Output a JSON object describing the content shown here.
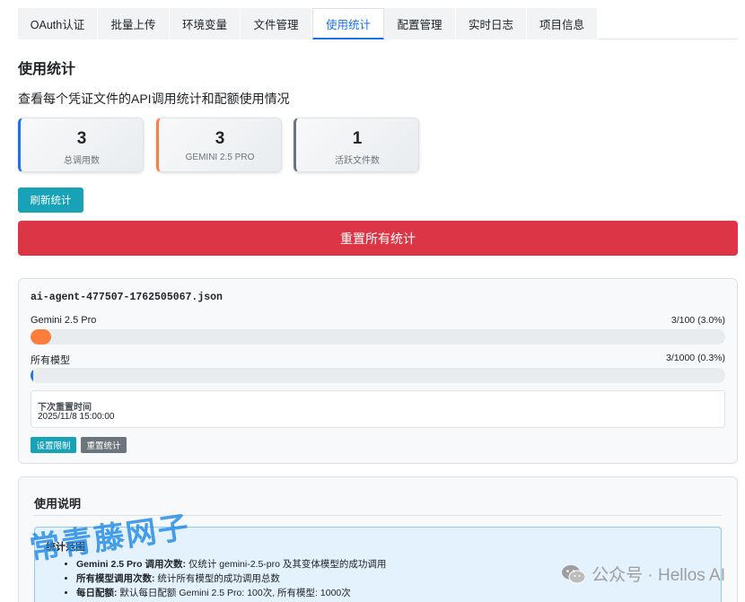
{
  "tabs": [
    {
      "label": "OAuth认证"
    },
    {
      "label": "批量上传"
    },
    {
      "label": "环境变量"
    },
    {
      "label": "文件管理"
    },
    {
      "label": "使用统计"
    },
    {
      "label": "配置管理"
    },
    {
      "label": "实时日志"
    },
    {
      "label": "项目信息"
    }
  ],
  "active_tab": "使用统计",
  "page": {
    "title": "使用统计",
    "description": "查看每个凭证文件的API调用统计和配额使用情况"
  },
  "stats": [
    {
      "value": "3",
      "label": "总调用数",
      "color": "#1a73e8"
    },
    {
      "value": "3",
      "label": "GEMINI 2.5 PRO",
      "color": "#fd7e3c"
    },
    {
      "value": "1",
      "label": "活跃文件数",
      "color": "#6c757d"
    }
  ],
  "buttons": {
    "refresh": "刷新统计",
    "reset_all": "重置所有统计"
  },
  "file": {
    "name": "ai-agent-477507-1762505067.json",
    "rows": [
      {
        "label": "Gemini 2.5 Pro",
        "value": "3/100 (3.0%)",
        "percent": 3.0,
        "color": "#fd7e3c"
      },
      {
        "label": "所有模型",
        "value": "3/1000 (0.3%)",
        "percent": 0.3,
        "color": "#1a73e8"
      }
    ],
    "next_reset_label": "下次重置时间",
    "next_reset_value": "2025/11/8 15:00:00",
    "set_limit": "设置限制",
    "reset_stats": "重置统计"
  },
  "help": {
    "title": "使用说明",
    "box_title": "统计范围",
    "items": [
      {
        "key": "Gemini 2.5 Pro 调用次数:",
        "text": " 仅统计 gemini-2.5-pro 及其变体模型的成功调用"
      },
      {
        "key": "所有模型调用次数:",
        "text": " 统计所有模型的成功调用总数"
      },
      {
        "key": "每日配额:",
        "text": " 默认每日配额 Gemini 2.5 Pro: 100次, 所有模型: 1000次"
      }
    ]
  },
  "watermark": {
    "text": "常青藤网子",
    "brand": "公众号 · Hellos AI",
    "brand_color": "#9e9e9e",
    "text_color": "#1e88e5"
  }
}
